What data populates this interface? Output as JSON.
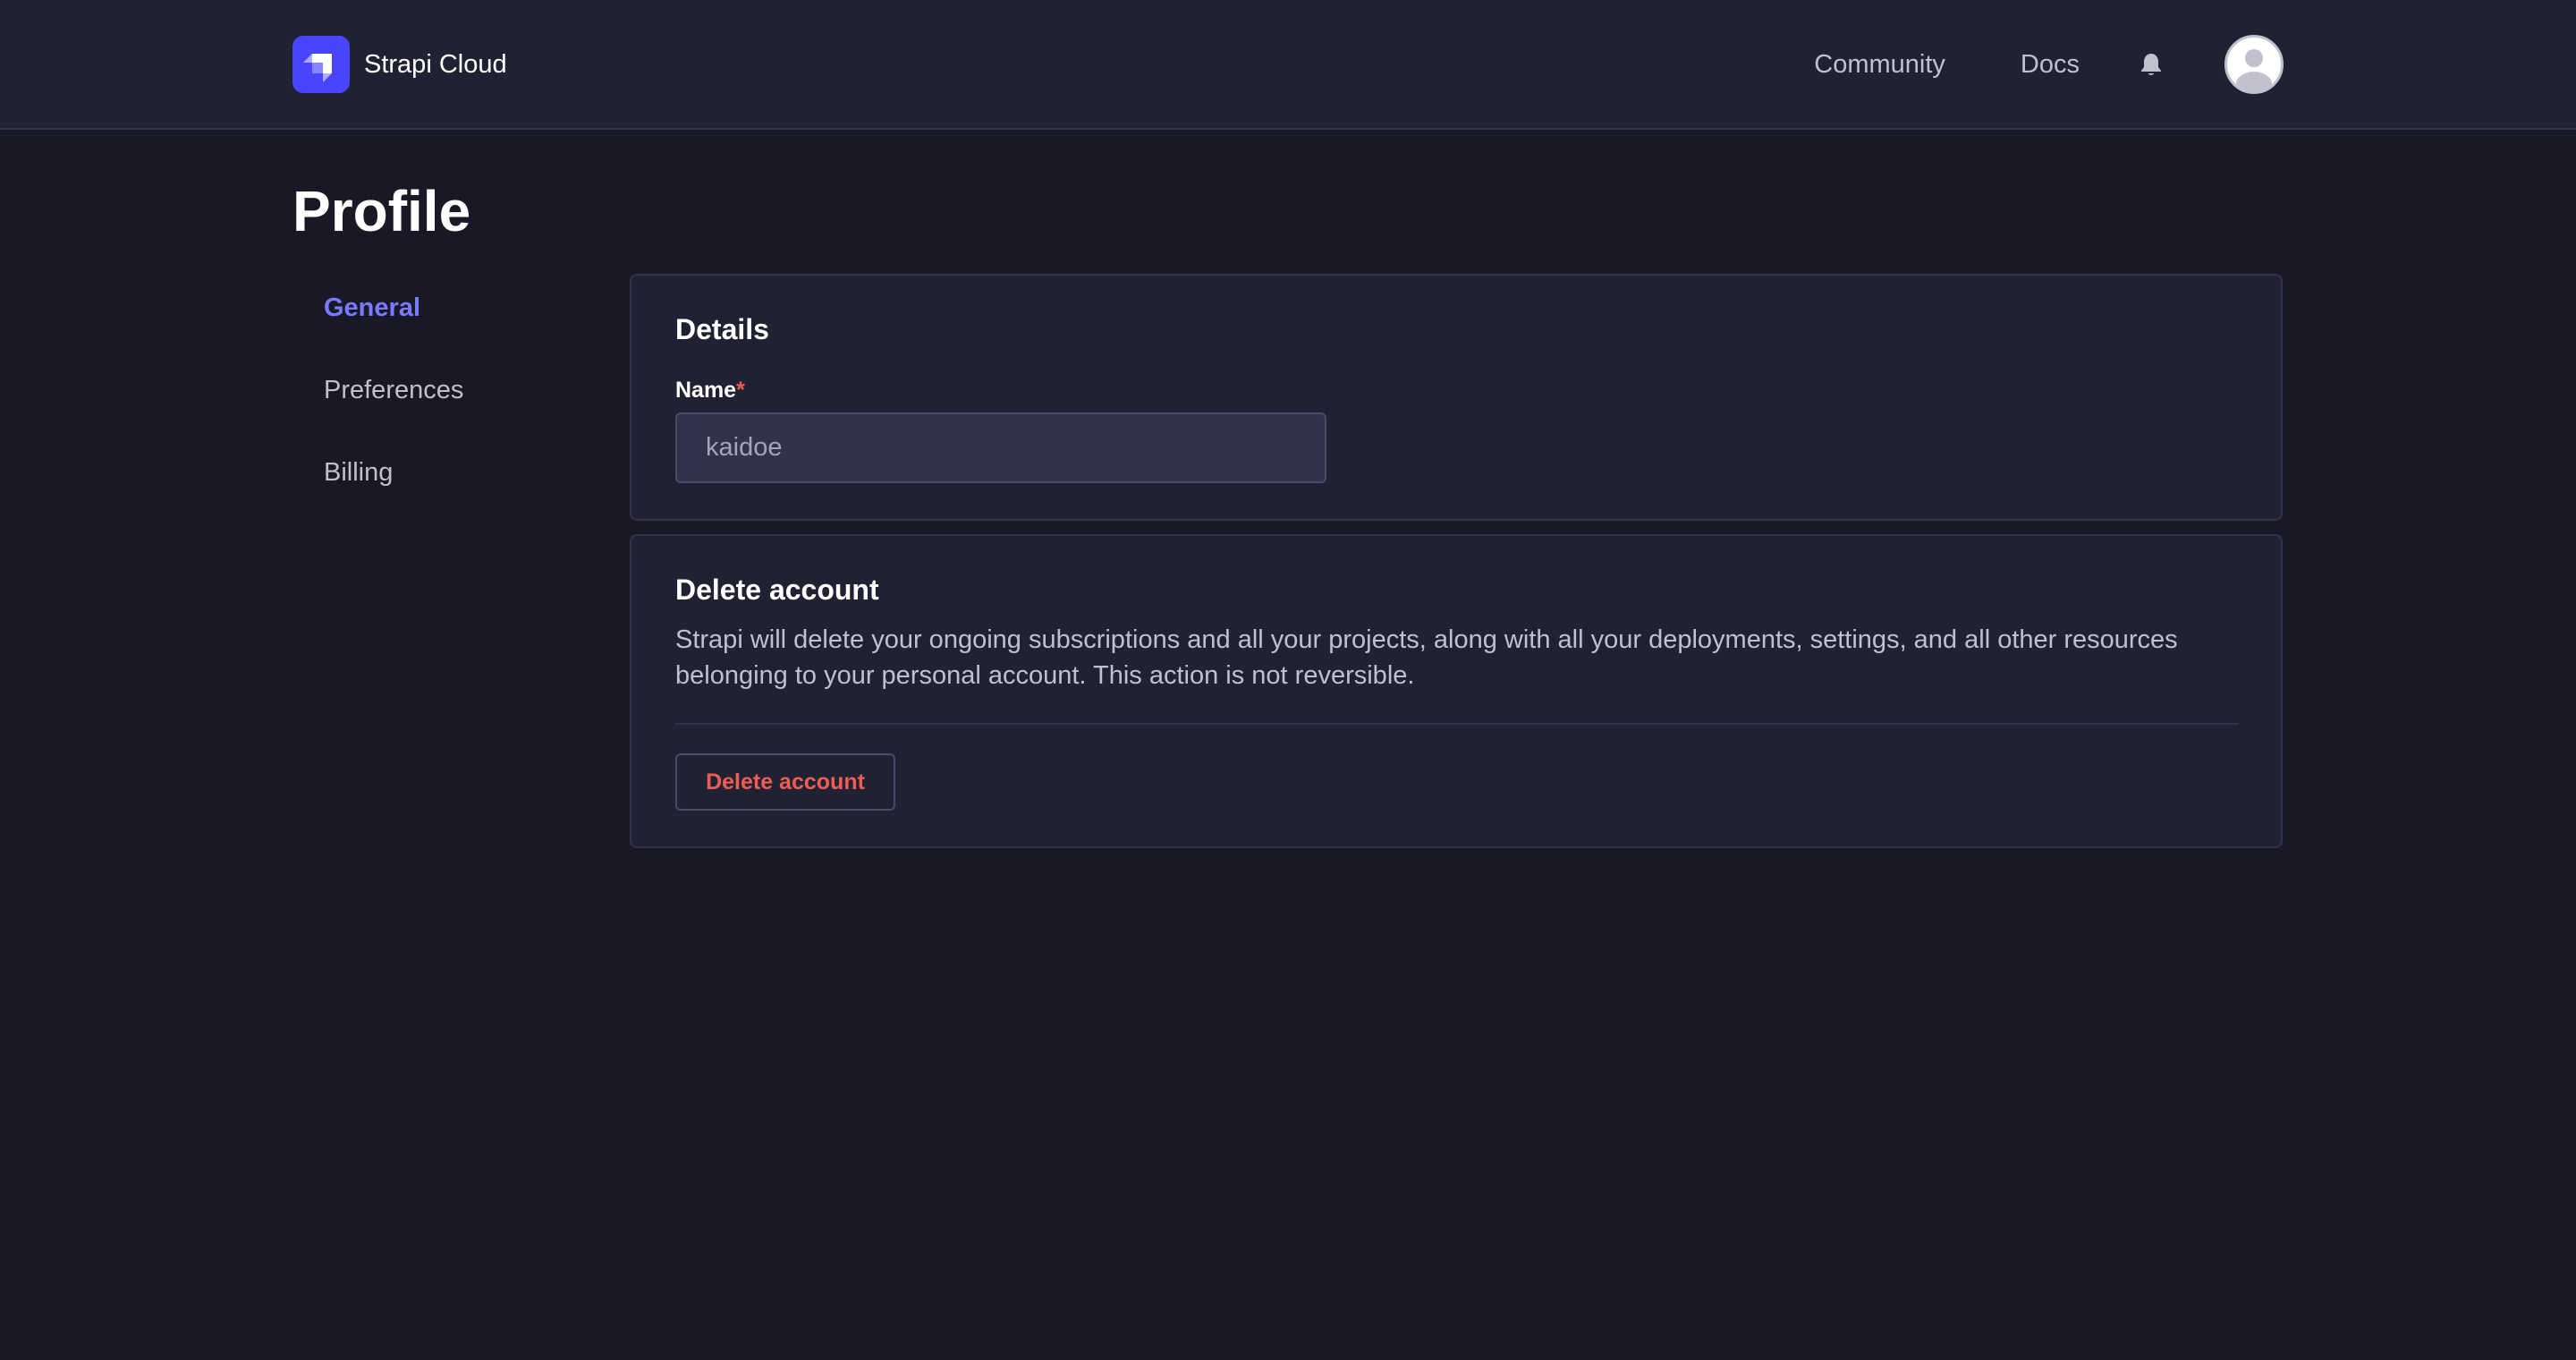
{
  "header": {
    "brand_name": "Strapi Cloud",
    "nav": {
      "community": "Community",
      "docs": "Docs"
    },
    "icons": {
      "logo": "strapi-logo-icon",
      "notifications": "bell-icon",
      "avatar": "user-avatar-icon"
    }
  },
  "page": {
    "title": "Profile"
  },
  "sidebar": {
    "items": [
      {
        "label": "General",
        "active": true
      },
      {
        "label": "Preferences",
        "active": false
      },
      {
        "label": "Billing",
        "active": false
      }
    ]
  },
  "details": {
    "title": "Details",
    "name_label": "Name",
    "required_mark": "*",
    "name_value": "kaidoe"
  },
  "delete_account": {
    "title": "Delete account",
    "description": "Strapi will delete your ongoing subscriptions and all your projects, along with all your deployments, settings, and all other resources belonging to your personal account. This action is not reversible.",
    "button_label": "Delete account"
  },
  "colors": {
    "accent": "#7b79ff",
    "brand": "#4945ff",
    "danger": "#ee5e52",
    "background": "#181826",
    "surface": "#212134"
  }
}
